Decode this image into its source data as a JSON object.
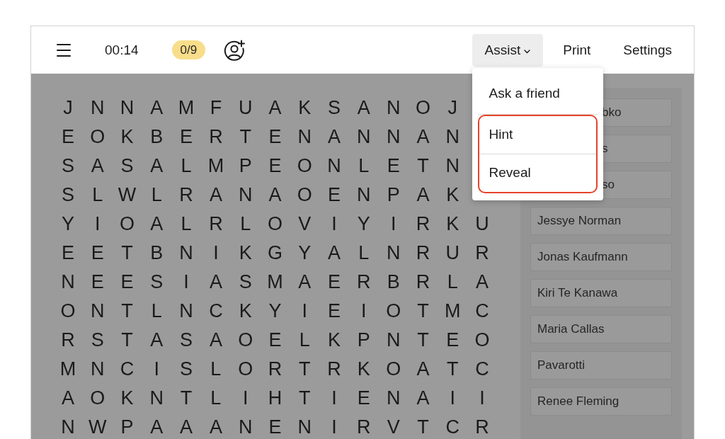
{
  "toolbar": {
    "timer": "00:14",
    "progress_badge": "0/9",
    "actions": [
      {
        "label": "Assist",
        "kind": "dropdown",
        "expanded": true
      },
      {
        "label": "Print",
        "kind": "link",
        "expanded": false
      },
      {
        "label": "Settings",
        "kind": "link",
        "expanded": false
      }
    ]
  },
  "assist_menu": {
    "items": [
      {
        "label": "Ask a friend",
        "highlighted": false
      },
      {
        "label": "Hint",
        "highlighted": true
      },
      {
        "label": "Reveal",
        "highlighted": true
      }
    ]
  },
  "grid": {
    "rows": [
      [
        "J",
        "N",
        "N",
        "A",
        "M",
        "F",
        "U",
        "A",
        "K",
        "S",
        "A",
        "N",
        "O",
        "J"
      ],
      [
        "E",
        "O",
        "K",
        "B",
        "E",
        "R",
        "T",
        "E",
        "N",
        "A",
        "N",
        "N",
        "A",
        "N"
      ],
      [
        "S",
        "A",
        "S",
        "A",
        "L",
        "M",
        "P",
        "E",
        "O",
        "N",
        "L",
        "E",
        "T",
        "N"
      ],
      [
        "S",
        "L",
        "W",
        "L",
        "R",
        "A",
        "N",
        "A",
        "O",
        "E",
        "N",
        "P",
        "A",
        "K"
      ],
      [
        "Y",
        "I",
        "O",
        "A",
        "L",
        "R",
        "L",
        "O",
        "V",
        "I",
        "Y",
        "I",
        "R",
        "K",
        "U"
      ],
      [
        "E",
        "E",
        "T",
        "B",
        "N",
        "I",
        "K",
        "G",
        "Y",
        "A",
        "L",
        "N",
        "R",
        "U",
        "R"
      ],
      [
        "N",
        "E",
        "E",
        "S",
        "I",
        "A",
        "S",
        "M",
        "A",
        "E",
        "R",
        "B",
        "R",
        "L",
        "A"
      ],
      [
        "O",
        "N",
        "T",
        "L",
        "N",
        "C",
        "K",
        "Y",
        "I",
        "E",
        "I",
        "O",
        "T",
        "M",
        "C"
      ],
      [
        "R",
        "S",
        "T",
        "A",
        "S",
        "A",
        "O",
        "E",
        "L",
        "K",
        "P",
        "N",
        "T",
        "E",
        "O"
      ],
      [
        "M",
        "N",
        "C",
        "I",
        "S",
        "L",
        "O",
        "R",
        "T",
        "R",
        "K",
        "O",
        "A",
        "T",
        "C"
      ],
      [
        "A",
        "O",
        "K",
        "N",
        "T",
        "L",
        "I",
        "H",
        "T",
        "I",
        "E",
        "N",
        "A",
        "I",
        "I"
      ],
      [
        "N",
        "W",
        "P",
        "A",
        "A",
        "A",
        "N",
        "E",
        "N",
        "I",
        "R",
        "V",
        "T",
        "C",
        "R"
      ]
    ]
  },
  "word_list": [
    {
      "label": "bko",
      "covered": true
    },
    {
      "label": "s",
      "covered": true
    },
    {
      "label": "so",
      "covered": true
    },
    {
      "label": "Jessye Norman",
      "covered": false
    },
    {
      "label": "Jonas Kaufmann",
      "covered": false
    },
    {
      "label": "Kiri Te Kanawa",
      "covered": false
    },
    {
      "label": "Maria Callas",
      "covered": false
    },
    {
      "label": "Pavarotti",
      "covered": false
    },
    {
      "label": "Renee Fleming",
      "covered": false
    }
  ]
}
